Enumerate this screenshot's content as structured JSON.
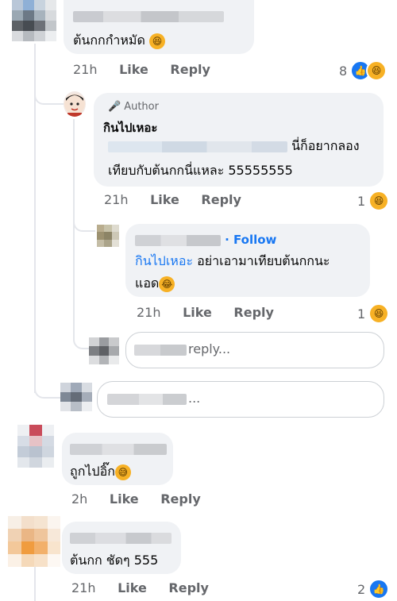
{
  "comments": [
    {
      "text": "ต้นกกกำหมัด",
      "time": "21h",
      "like_label": "Like",
      "reply_label": "Reply",
      "reaction_count": "8"
    },
    {
      "author_tag": "Author",
      "name": "กินไปเหอะ",
      "text_line1": "นี่ก็อยากลอง",
      "text_line2": "เทียบกับต้นกกนี่แหละ 55555555",
      "time": "21h",
      "like_label": "Like",
      "reply_label": "Reply",
      "reaction_count": "1"
    },
    {
      "follow_label": "· Follow",
      "mention": "กินไปเหอะ",
      "text_line1": " อย่าเอามาเทียบต้นกกนะ",
      "text_line2": "แอด",
      "time": "21h",
      "like_label": "Like",
      "reply_label": "Reply",
      "reaction_count": "1"
    },
    {
      "text": "ถูกไปอิ๊ก",
      "time": "2h",
      "like_label": "Like",
      "reply_label": "Reply"
    },
    {
      "text": "ต้นกก ชัดๆ 555",
      "time": "21h",
      "like_label": "Like",
      "reply_label": "Reply",
      "reaction_count": "2"
    }
  ],
  "reply_input": {
    "placeholder": "reply..."
  },
  "comment_input": {
    "placeholder": "..."
  },
  "colors": {
    "accent": "#1877f2",
    "bubble": "#f0f2f5",
    "meta": "#65676b"
  }
}
